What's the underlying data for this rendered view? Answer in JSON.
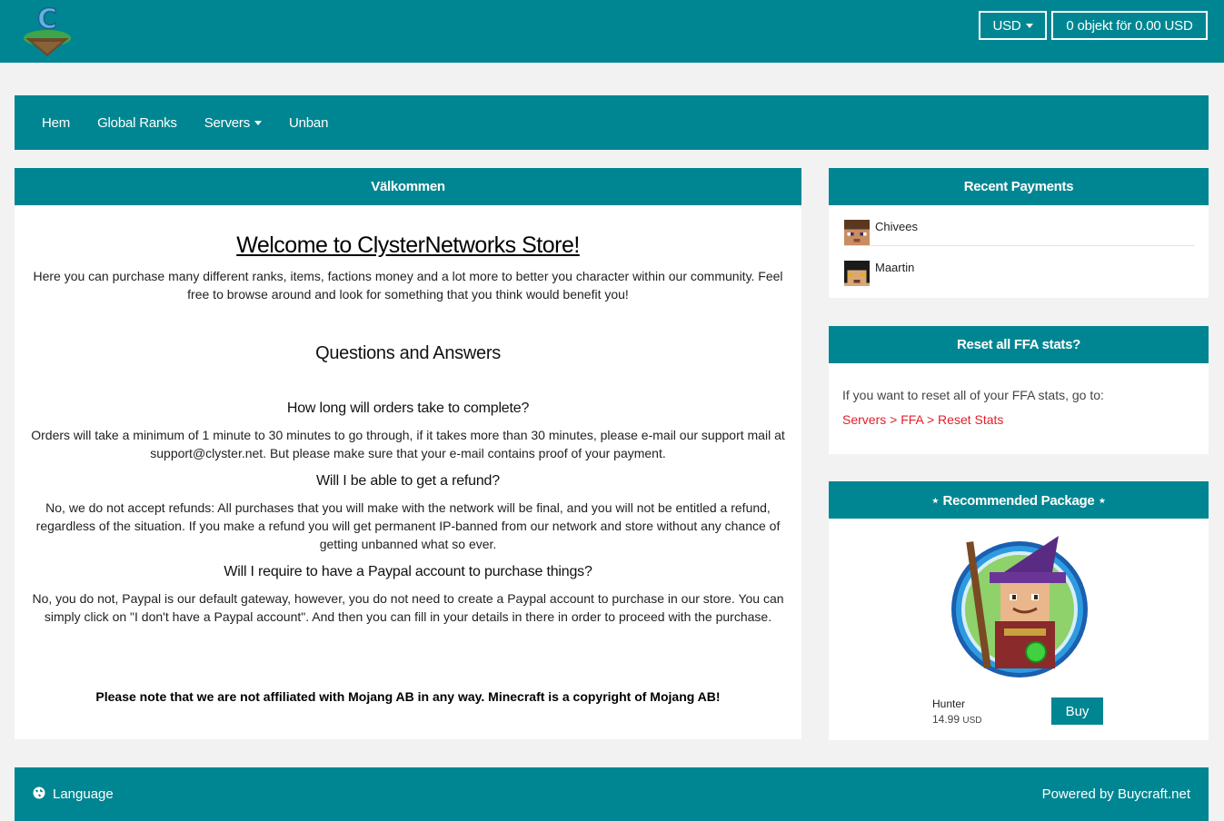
{
  "header": {
    "currency": "USD",
    "cart": "0 objekt för 0.00 USD"
  },
  "nav": {
    "items": [
      "Hem",
      "Global Ranks",
      "Servers",
      "Unban"
    ]
  },
  "main": {
    "title": "Välkommen",
    "welcome": "Welcome to ClysterNetworks Store!",
    "intro": "Here you can purchase many different ranks, items, factions money and a lot more to better you character within our community. Feel free to browse around and look for something that you think would benefit you!",
    "qa_title": "Questions and Answers",
    "qa": [
      {
        "q": "How long will orders take to complete?",
        "a": "Orders will take a minimum of 1 minute to 30 minutes to go through, if it takes more than 30 minutes, please e-mail our support mail at support@clyster.net. But please make sure that your e-mail contains proof of your payment."
      },
      {
        "q": "Will I be able to get a refund?",
        "a": "No, we do not accept refunds: All purchases that you will make with the network will be final, and you will not be entitled a refund, regardless of the situation. If you make a refund you will get permanent IP-banned from our network and store without any chance of getting unbanned what so ever."
      },
      {
        "q": "Will I require to have a Paypal account to purchase things?",
        "a": "No, you do not, Paypal is our default gateway, however, you do not need to create a Paypal account to purchase in our store. You can simply click on \"I don't have a Paypal account\". And then you can fill in your details in there in order to proceed with the purchase."
      }
    ],
    "notice": "Please note that we are not affiliated with Mojang AB in any way. Minecraft is a copyright of Mojang AB!"
  },
  "recent_payments": {
    "title": "Recent Payments",
    "items": [
      {
        "name": "Chivees"
      },
      {
        "name": "Maartin"
      }
    ]
  },
  "reset": {
    "title": "Reset all FFA stats?",
    "text": "If you want to reset all of your FFA stats, go to:",
    "link": "Servers > FFA > Reset Stats"
  },
  "recommended": {
    "title": "⋆ Recommended Package ⋆",
    "name": "Hunter",
    "price": "14.99",
    "currency": "USD",
    "buy_label": "Buy"
  },
  "footer": {
    "language": "Language",
    "powered": "Powered by Buycraft.net"
  },
  "colors": {
    "primary": "#008692",
    "link_red": "#e0202a"
  }
}
